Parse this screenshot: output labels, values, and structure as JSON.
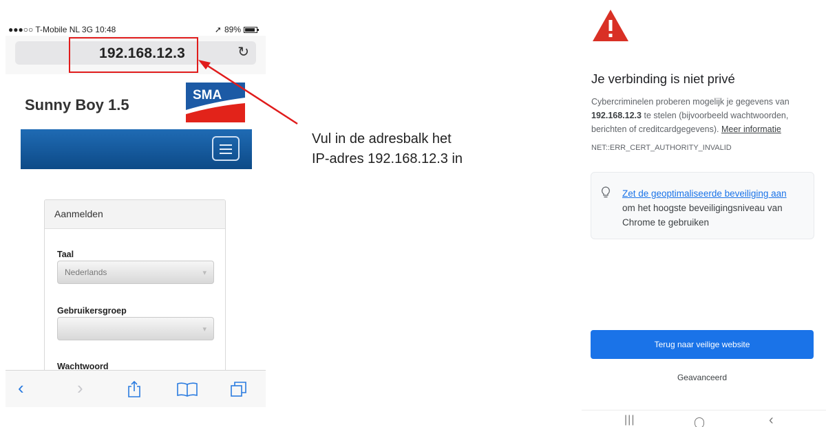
{
  "left_phone": {
    "status": {
      "carrier": "●●●○○ T-Mobile NL  3G  10:48",
      "battery_text": "89%",
      "location_icon": "location-arrow-icon"
    },
    "url": "192.168.12.3",
    "reload_icon": "reload-icon",
    "site_title": "Sunny Boy 1.5",
    "logo_text": "SMA",
    "login": {
      "heading": "Aanmelden",
      "language_label": "Taal",
      "language_value": "Nederlands",
      "usergroup_label": "Gebruikersgroep",
      "usergroup_value": "",
      "password_label": "Wachtwoord"
    },
    "toolbar_icons": [
      "back-icon",
      "forward-icon",
      "share-icon",
      "bookmarks-icon",
      "tabs-icon"
    ]
  },
  "annotation": {
    "line1": "Vul in de adresbalk het",
    "line2": "IP-adres 192.168.12.3 in"
  },
  "right_phone": {
    "warning_icon": "warning-triangle-icon",
    "title": "Je verbinding is niet privé",
    "body_before": "Cybercriminelen proberen mogelijk je gegevens van ",
    "body_bold": "192.168.12.3",
    "body_after": " te stelen (bijvoorbeeld wachtwoorden, berichten of creditcardgegevens). ",
    "more_info": "Meer informatie",
    "error_code": "NET::ERR_CERT_AUTHORITY_INVALID",
    "tip_link": "Zet de geoptimaliseerde beveiliging aan",
    "tip_rest": "om het hoogste beveiligingsniveau van Chrome te gebruiken",
    "primary_button": "Terug naar veilige website",
    "advanced_button": "Geavanceerd",
    "nav_icons": [
      "recents-icon",
      "home-icon",
      "back-icon"
    ]
  },
  "colors": {
    "highlight_red": "#e01b1b",
    "sma_blue": "#0d4a87",
    "chrome_blue": "#1a73e8",
    "warning_red": "#d93025"
  }
}
